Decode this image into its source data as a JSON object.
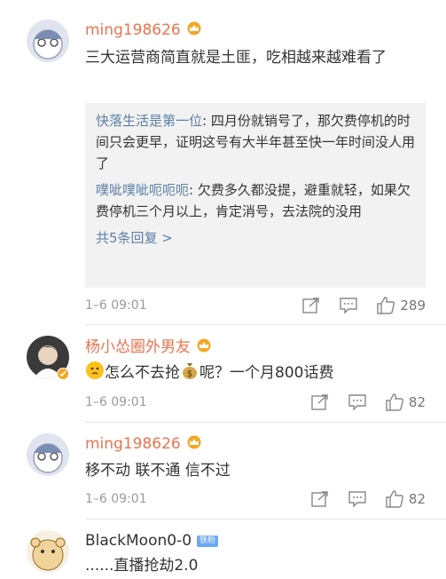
{
  "comments": [
    {
      "username": "ming198626",
      "text": "三大运营商简直就是土匪，吃相越来越难看了",
      "replies": [
        {
          "user": "快落生活是第一位",
          "text": ": 四月份就销号了，那欠费停机的时间只会更早，证明这号有大半年甚至快一年时间没人用了"
        },
        {
          "user": "噗呲噗呲呃呃呃",
          "text": ": 欠费多久都没提，避重就轻，如果欠费停机三个月以上，肯定消号，去法院的没用"
        }
      ],
      "more_replies": "共5条回复 >",
      "time": "1–6 09:01",
      "likes": "289"
    },
    {
      "username": "杨小怂圈外男友",
      "text_before": "怎么不去抢",
      "text_after": "呢？一个月800话费",
      "time": "1–6 09:01",
      "likes": "82"
    },
    {
      "username": "ming198626",
      "text": "移不动 联不通 信不过",
      "time": "1–6 09:01",
      "likes": "82"
    },
    {
      "username": "BlackMoon0-0",
      "badge": "铁粉",
      "text": "......直播抢劫2.0"
    }
  ],
  "colors": {
    "username_orange": "#eb7350",
    "reply_user_blue": "#5b7fa6",
    "reply_bg": "#f2f2f2",
    "meta_gray": "#9a9a9a"
  },
  "icons": [
    "crown-badge-icon",
    "share-icon",
    "comment-icon",
    "like-icon",
    "money-bag-icon",
    "thinking-face-icon"
  ]
}
